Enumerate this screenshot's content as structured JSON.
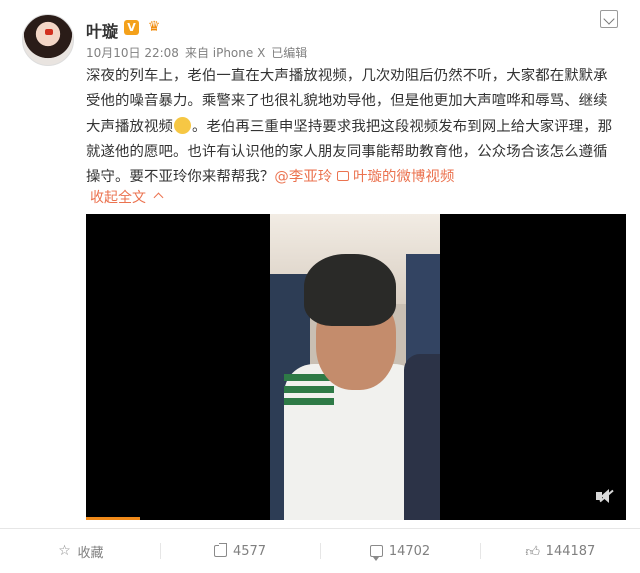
{
  "post": {
    "username": "叶璇",
    "verified_badge": "V",
    "meta": {
      "date": "10月10日 22:08",
      "source": "来自 iPhone X",
      "edited": "已编辑"
    },
    "text": {
      "part1": "深夜的列车上，老伯一直在大声播放视频，几次劝阻后仍然不听，大家都在默默承受他的噪音暴力。乘警来了也很礼貌地劝导他，但是他更加大声喧哗和辱骂、继续大声播放视频",
      "part2": "。老伯再三重申坚持要求我把这段视频发布到网上给大家评理，那就遂他的愿吧。也许有认识他的家人朋友同事能帮助教育他，公众场合该怎么遵循操守。要不亚玲你来帮帮我？",
      "mention": "@李亚玲",
      "video_link": "叶璇的微博视频"
    },
    "collapse_label": "收起全文"
  },
  "icons": {
    "avatar": "avatar",
    "verified": "verified-badge-icon",
    "crown": "crown-icon",
    "emoji": "sleepy-face-emoji-icon",
    "more": "chevron-down-icon",
    "video_link": "video-link-icon",
    "mute": "mute-icon",
    "favorite": "star-icon",
    "repost": "repost-icon",
    "comment": "comment-icon",
    "like": "thumbs-up-icon"
  },
  "video": {
    "progress": 0.1
  },
  "actions": {
    "favorite_label": "收藏",
    "repost_count": "4577",
    "comment_count": "14702",
    "like_count": "144187"
  },
  "colors": {
    "accent": "#eb7350",
    "progress": "#f08a1a",
    "text": "#333333",
    "muted": "#808080"
  }
}
